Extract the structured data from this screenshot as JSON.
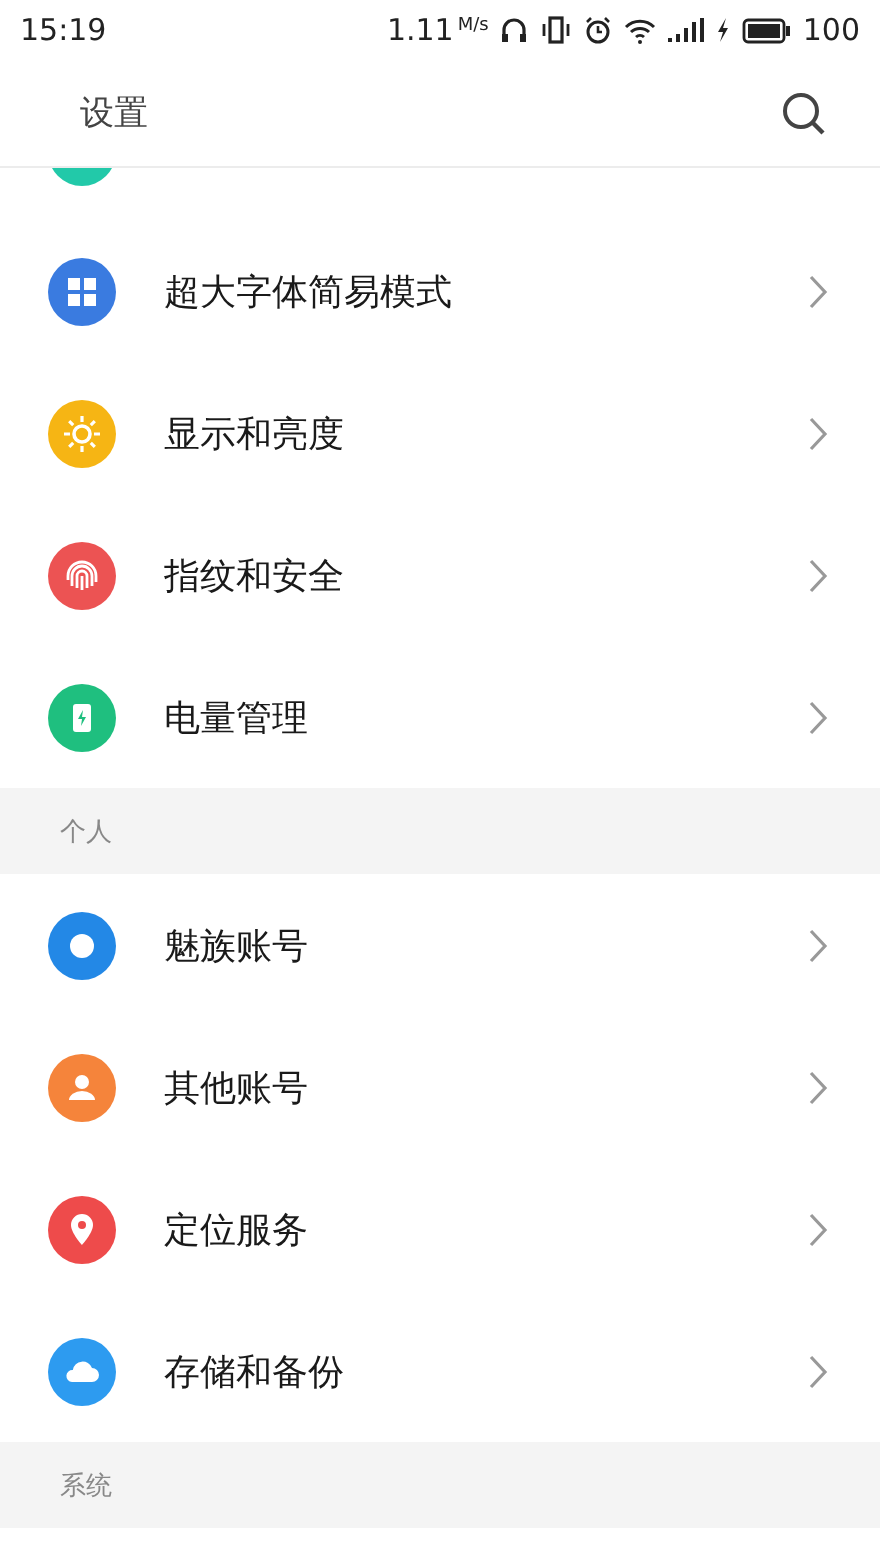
{
  "status_bar": {
    "time": "15:19",
    "speed": "1.11",
    "speed_unit": "M/s",
    "battery": "100"
  },
  "header": {
    "title": "设置"
  },
  "sections": [
    {
      "items": [
        {
          "kind": "cut",
          "color": "#22c9a9"
        },
        {
          "kind": "grid",
          "label": "超大字体简易模式",
          "color": "#3a7be0"
        },
        {
          "kind": "sun",
          "label": "显示和亮度",
          "color": "#f6b514"
        },
        {
          "kind": "fingerprint",
          "label": "指纹和安全",
          "color": "#ec5353"
        },
        {
          "kind": "battery",
          "label": "电量管理",
          "color": "#1fbf7f"
        }
      ]
    },
    {
      "header": "个人",
      "items": [
        {
          "kind": "ring",
          "label": "魅族账号",
          "color": "#2388e6"
        },
        {
          "kind": "person",
          "label": "其他账号",
          "color": "#f5843b"
        },
        {
          "kind": "pin",
          "label": "定位服务",
          "color": "#ee4b4b"
        },
        {
          "kind": "cloud",
          "label": "存储和备份",
          "color": "#2d9bf0"
        }
      ]
    },
    {
      "header": "系统"
    }
  ]
}
